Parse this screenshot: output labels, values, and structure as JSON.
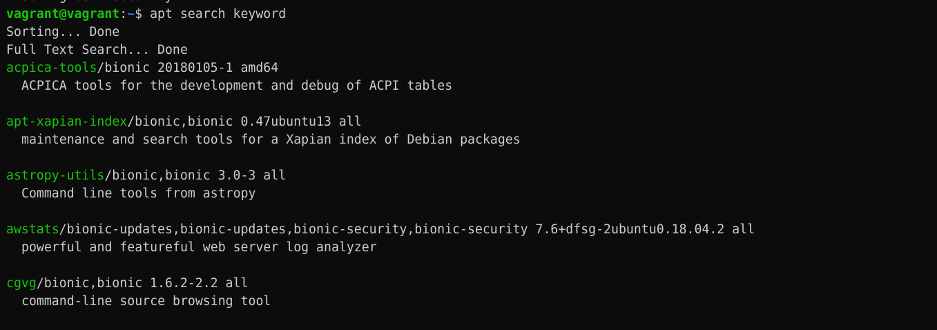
{
  "partial_top_line": "Enabling conf security.",
  "prompt": {
    "user_host": "vagrant@vagrant",
    "colon": ":",
    "path": "~",
    "symbol": "$ ",
    "command": "apt search keyword"
  },
  "status_lines": [
    "Sorting... Done",
    "Full Text Search... Done"
  ],
  "packages": [
    {
      "name": "acpica-tools",
      "details": "/bionic 20180105-1 amd64",
      "description": "ACPICA tools for the development and debug of ACPI tables"
    },
    {
      "name": "apt-xapian-index",
      "details": "/bionic,bionic 0.47ubuntu13 all",
      "description": "maintenance and search tools for a Xapian index of Debian packages"
    },
    {
      "name": "astropy-utils",
      "details": "/bionic,bionic 3.0-3 all",
      "description": "Command line tools from astropy"
    },
    {
      "name": "awstats",
      "details": "/bionic-updates,bionic-updates,bionic-security,bionic-security 7.6+dfsg-2ubuntu0.18.04.2 all",
      "description": "powerful and featureful web server log analyzer"
    },
    {
      "name": "cgvg",
      "details": "/bionic,bionic 1.6.2-2.2 all",
      "description": "command-line source browsing tool"
    }
  ],
  "colors": {
    "background": "#0c0c0c",
    "foreground": "#cccccc",
    "green": "#16c60c",
    "blue": "#3b78ff"
  }
}
